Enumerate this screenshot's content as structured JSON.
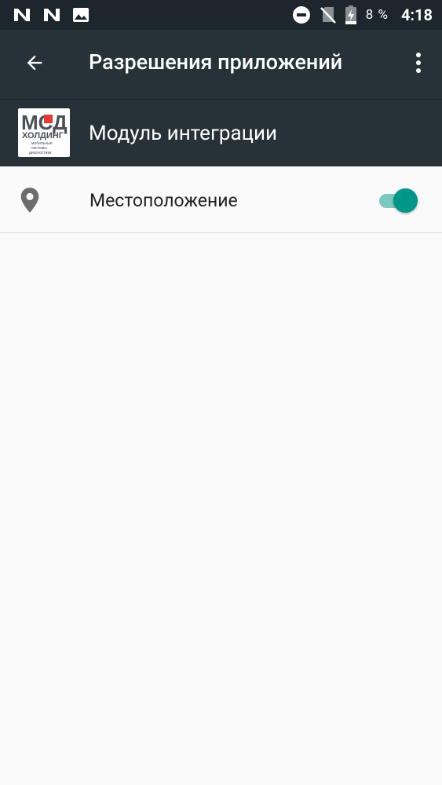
{
  "status_bar": {
    "battery_percent": "8 %",
    "time": "4:18",
    "icons": [
      "n-notification-icon",
      "n-notification-icon",
      "image-notification-icon",
      "do-not-disturb-icon",
      "no-sim-icon",
      "battery-charging-icon"
    ]
  },
  "app_bar": {
    "title": "Разрешения приложений",
    "back_icon": "arrow-back-icon",
    "menu_icon": "more-vert-icon"
  },
  "app_header": {
    "app_name": "Модуль интеграции",
    "logo": {
      "line1": "МСД",
      "line2": "ХОЛДИНГ",
      "line3": "мобильные",
      "line4": "системы",
      "line5": "диагностики"
    }
  },
  "permissions": [
    {
      "label": "Местоположение",
      "icon": "location-pin-icon",
      "enabled": true
    }
  ],
  "colors": {
    "status_bar": "#1c262c",
    "app_bar": "#263238",
    "accent": "#009688",
    "background": "#fafafa",
    "logo_red": "#e53935"
  }
}
